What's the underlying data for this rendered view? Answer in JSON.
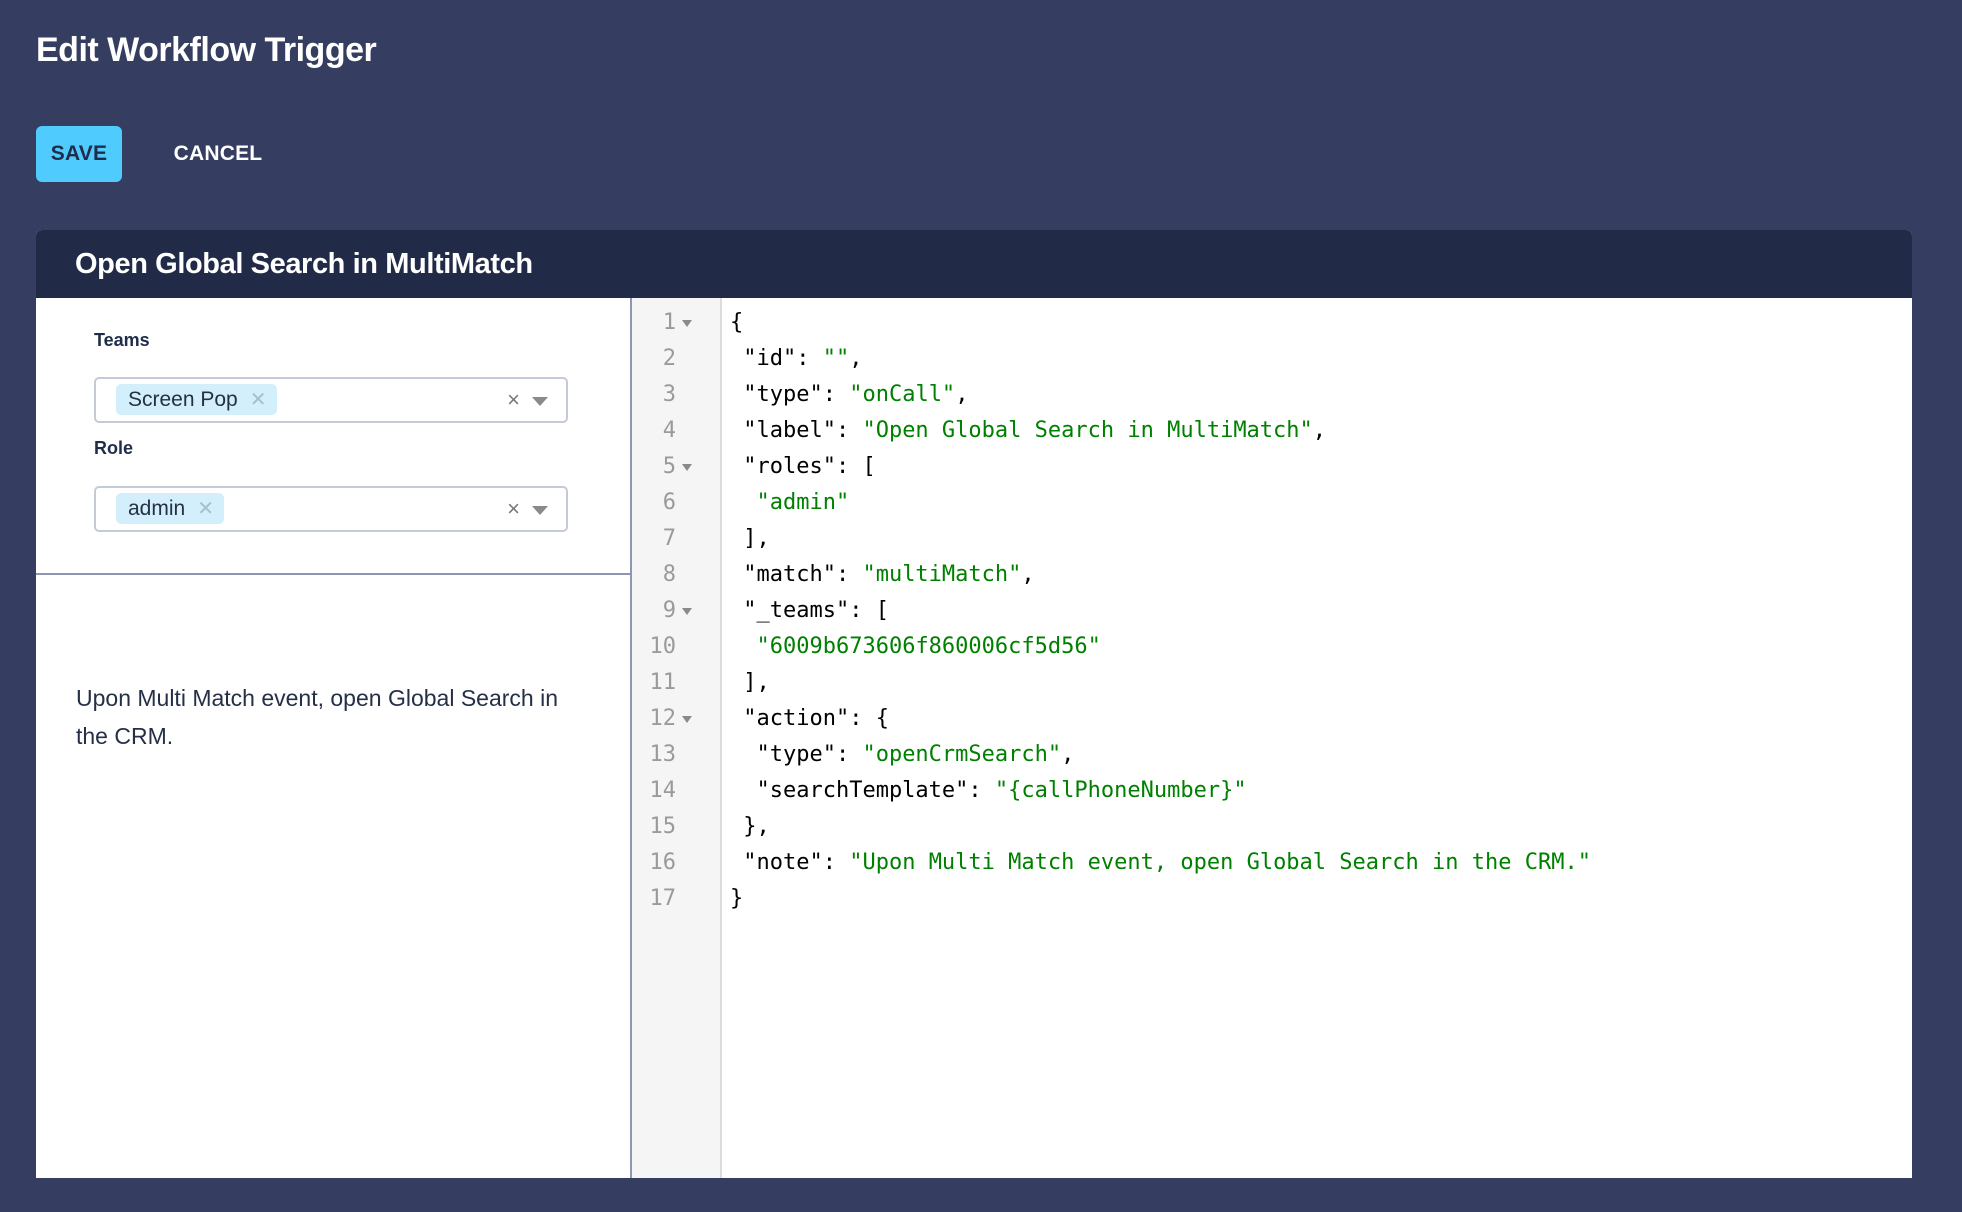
{
  "page": {
    "title": "Edit Workflow Trigger"
  },
  "toolbar": {
    "save_label": "SAVE",
    "cancel_label": "CANCEL"
  },
  "colors": {
    "background": "#353e60",
    "card_header": "#212b48",
    "save_button": "#4fcbfd",
    "chip": "#d3effc",
    "json_string": "#008000"
  },
  "card": {
    "title": "Open Global Search in MultiMatch",
    "form": {
      "teams": {
        "label": "Teams",
        "chips": [
          "Screen Pop"
        ],
        "clear_icon": "close-icon",
        "dropdown_icon": "caret-down-icon"
      },
      "role": {
        "label": "Role",
        "chips": [
          "admin"
        ],
        "clear_icon": "close-icon",
        "dropdown_icon": "caret-down-icon"
      }
    },
    "description": "Upon Multi Match event, open Global Search in the CRM.",
    "editor": {
      "lines": [
        {
          "n": "1",
          "fold": true,
          "tokens": [
            {
              "t": "{",
              "c": "p"
            }
          ]
        },
        {
          "n": "2",
          "fold": false,
          "tokens": [
            {
              "t": " \"id\": ",
              "c": "k"
            },
            {
              "t": "\"\"",
              "c": "s"
            },
            {
              "t": ",",
              "c": "p"
            }
          ]
        },
        {
          "n": "3",
          "fold": false,
          "tokens": [
            {
              "t": " \"type\": ",
              "c": "k"
            },
            {
              "t": "\"onCall\"",
              "c": "s"
            },
            {
              "t": ",",
              "c": "p"
            }
          ]
        },
        {
          "n": "4",
          "fold": false,
          "tokens": [
            {
              "t": " \"label\": ",
              "c": "k"
            },
            {
              "t": "\"Open Global Search in MultiMatch\"",
              "c": "s"
            },
            {
              "t": ",",
              "c": "p"
            }
          ]
        },
        {
          "n": "5",
          "fold": true,
          "tokens": [
            {
              "t": " \"roles\": [",
              "c": "k"
            }
          ]
        },
        {
          "n": "6",
          "fold": false,
          "tokens": [
            {
              "t": "  ",
              "c": "p"
            },
            {
              "t": "\"admin\"",
              "c": "s"
            }
          ]
        },
        {
          "n": "7",
          "fold": false,
          "tokens": [
            {
              "t": " ],",
              "c": "p"
            }
          ]
        },
        {
          "n": "8",
          "fold": false,
          "tokens": [
            {
              "t": " \"match\": ",
              "c": "k"
            },
            {
              "t": "\"multiMatch\"",
              "c": "s"
            },
            {
              "t": ",",
              "c": "p"
            }
          ]
        },
        {
          "n": "9",
          "fold": true,
          "tokens": [
            {
              "t": " \"_teams\": [",
              "c": "k"
            }
          ]
        },
        {
          "n": "10",
          "fold": false,
          "tokens": [
            {
              "t": "  ",
              "c": "p"
            },
            {
              "t": "\"6009b673606f860006cf5d56\"",
              "c": "s"
            }
          ]
        },
        {
          "n": "11",
          "fold": false,
          "tokens": [
            {
              "t": " ],",
              "c": "p"
            }
          ]
        },
        {
          "n": "12",
          "fold": true,
          "tokens": [
            {
              "t": " \"action\": {",
              "c": "k"
            }
          ]
        },
        {
          "n": "13",
          "fold": false,
          "tokens": [
            {
              "t": "  \"type\": ",
              "c": "k"
            },
            {
              "t": "\"openCrmSearch\"",
              "c": "s"
            },
            {
              "t": ",",
              "c": "p"
            }
          ]
        },
        {
          "n": "14",
          "fold": false,
          "tokens": [
            {
              "t": "  \"searchTemplate\": ",
              "c": "k"
            },
            {
              "t": "\"{callPhoneNumber}\"",
              "c": "s"
            }
          ]
        },
        {
          "n": "15",
          "fold": false,
          "tokens": [
            {
              "t": " },",
              "c": "p"
            }
          ]
        },
        {
          "n": "16",
          "fold": false,
          "tokens": [
            {
              "t": " \"note\": ",
              "c": "k"
            },
            {
              "t": "\"Upon Multi Match event, open Global Search in the CRM.\"",
              "c": "s"
            }
          ]
        },
        {
          "n": "17",
          "fold": false,
          "tokens": [
            {
              "t": "}",
              "c": "p"
            }
          ]
        }
      ]
    }
  }
}
